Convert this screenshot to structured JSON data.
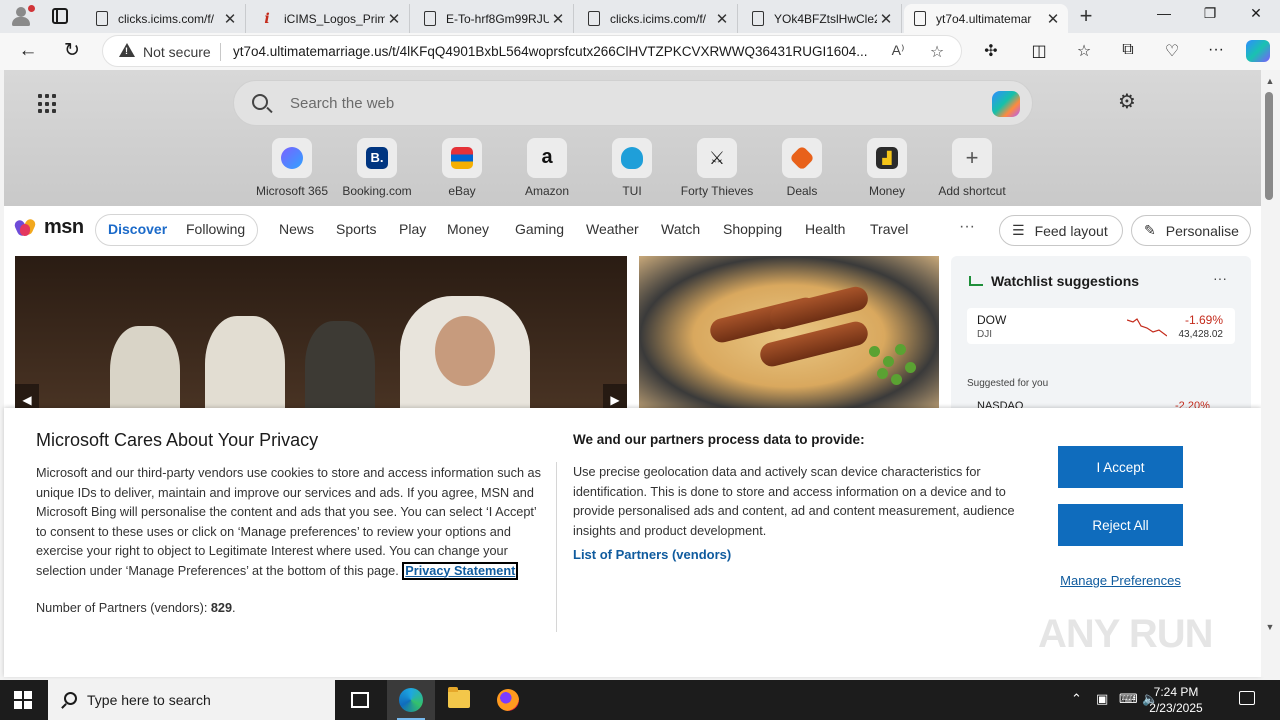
{
  "browser": {
    "tabs": [
      {
        "title": "clicks.icims.com/f/",
        "favicon": "document-icon"
      },
      {
        "title": "iCIMS_Logos_Prim",
        "favicon": "icims-icon"
      },
      {
        "title": "E-To-hrf8Gm99RJU",
        "favicon": "document-icon"
      },
      {
        "title": "clicks.icims.com/f/",
        "favicon": "document-icon"
      },
      {
        "title": "YOk4BFZtslHwCle2",
        "favicon": "document-icon"
      },
      {
        "title": "yt7o4.ultimatemar",
        "favicon": "document-icon",
        "active": true
      }
    ],
    "security_label": "Not secure",
    "url": "yt7o4.ultimatemarriage.us/t/4lKFqQ4901BxbL564woprsfcutx266ClHVTZPKCVXRWWQ36431RUGI1604..."
  },
  "newtab": {
    "search_placeholder": "Search the web",
    "shortcuts": [
      {
        "label": "Microsoft 365",
        "icon": "microsoft365-icon",
        "color": "#5b5fc7",
        "glyph": ""
      },
      {
        "label": "Booking.com",
        "icon": "booking-icon",
        "color": "#003580",
        "glyph": "B."
      },
      {
        "label": "eBay",
        "icon": "ebay-icon",
        "color": "#3b7d2e",
        "glyph": ""
      },
      {
        "label": "Amazon",
        "icon": "amazon-icon",
        "color": "#ffffff",
        "glyph": "a"
      },
      {
        "label": "TUI",
        "icon": "tui-icon",
        "color": "#1f9fd9",
        "glyph": ""
      },
      {
        "label": "Forty Thieves",
        "icon": "crossed-swords-icon",
        "color": "#ffffff",
        "glyph": "⚔"
      },
      {
        "label": "Deals",
        "icon": "deals-tag-icon",
        "color": "#e8611a",
        "glyph": ""
      },
      {
        "label": "Money",
        "icon": "money-chart-icon",
        "color": "#2b2b2b",
        "glyph": ""
      },
      {
        "label": "Add shortcut",
        "icon": "plus-icon",
        "color": "#ececec",
        "glyph": "+"
      }
    ]
  },
  "msn": {
    "logo_text": "msn",
    "feed_tabs": [
      "Discover",
      "Following"
    ],
    "selected_tab": "Discover",
    "nav": [
      "News",
      "Sports",
      "Play",
      "Money",
      "Gaming",
      "Weather",
      "Watch",
      "Shopping",
      "Health",
      "Travel"
    ],
    "more": "···",
    "feed_layout_label": "Feed layout",
    "personalise_label": "Personalise",
    "watchlist": {
      "title": "Watchlist suggestions",
      "quote": {
        "symbol": "DOW",
        "name": "DJI",
        "change": "-1.69%",
        "value": "43,428.02"
      },
      "suggested_label": "Suggested for you",
      "quote2": {
        "symbol": "NASDAQ",
        "change": "-2.20%"
      }
    }
  },
  "privacy": {
    "title": "Microsoft Cares About Your Privacy",
    "body": "Microsoft and our third-party vendors use cookies to store and access information such as unique IDs to deliver, maintain and improve our services and ads. If you agree, MSN and Microsoft Bing will personalise the content and ads that you see. You can select ‘I Accept’ to consent to these uses or click on ‘Manage preferences’ to review your options and exercise your right to object to Legitimate Interest where used.  You can change your selection under ‘Manage Preferences’ at the bottom of this page.",
    "privacy_link": "Privacy Statement",
    "partners_count_label": "Number of Partners (vendors):",
    "partners_count": "829",
    "process_title": "We and our partners process data to provide:",
    "process_body": "Use precise geolocation data and actively scan device characteristics for identification. This is done to store and access information on a device and to provide personalised ads and content, ad and content measurement, audience insights and product development.",
    "partners_link": "List of Partners (vendors)",
    "accept_label": "I Accept",
    "reject_label": "Reject All",
    "manage_label": "Manage Preferences",
    "accent": "#0f6cbd"
  },
  "watermark": "ANY RUN",
  "taskbar": {
    "search_placeholder": "Type here to search",
    "time": "7:24 PM",
    "date": "2/23/2025"
  }
}
